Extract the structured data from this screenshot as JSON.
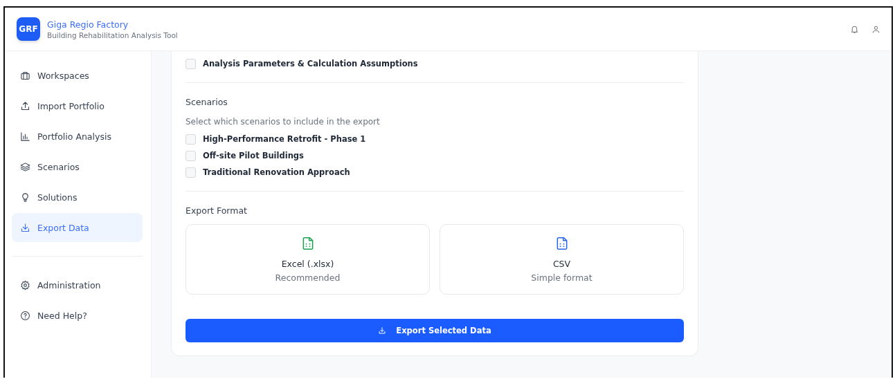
{
  "header": {
    "logo": "GRF",
    "title": "Giga Regio Factory",
    "subtitle": "Building Rehabilitation Analysis Tool"
  },
  "sidebar": {
    "items": [
      {
        "label": "Workspaces",
        "selected": false
      },
      {
        "label": "Import Portfolio",
        "selected": false
      },
      {
        "label": "Portfolio Analysis",
        "selected": false
      },
      {
        "label": "Scenarios",
        "selected": false
      },
      {
        "label": "Solutions",
        "selected": false
      },
      {
        "label": "Export Data",
        "selected": true
      }
    ],
    "bottom_items": [
      {
        "label": "Administration",
        "selected": false
      },
      {
        "label": "Need Help?",
        "selected": false
      }
    ]
  },
  "export": {
    "options": [
      {
        "label": "Analysis Parameters & Calculation Assumptions",
        "checked": false
      }
    ],
    "scenarios": {
      "title": "Scenarios",
      "hint": "Select which scenarios to include in the export",
      "items": [
        {
          "label": "High-Performance Retrofit - Phase 1",
          "checked": false
        },
        {
          "label": "Off-site Pilot Buildings",
          "checked": false
        },
        {
          "label": "Traditional Renovation Approach",
          "checked": false
        }
      ]
    },
    "format": {
      "title": "Export Format",
      "options": [
        {
          "label": "Excel (.xlsx)",
          "note": "Recommended",
          "color": "#16a34a",
          "selected": false
        },
        {
          "label": "CSV",
          "note": "Simple format",
          "color": "#2563eb",
          "selected": false
        }
      ]
    },
    "button": "Export Selected Data"
  }
}
